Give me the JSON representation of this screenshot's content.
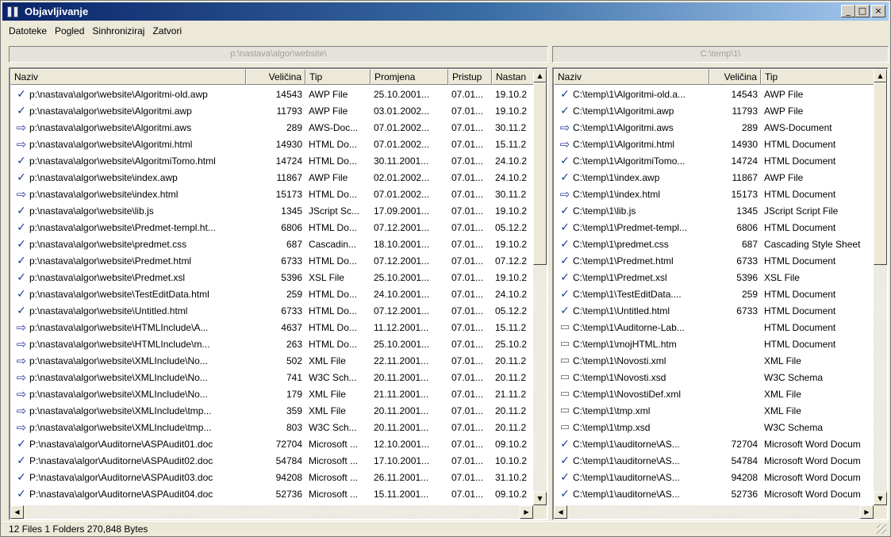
{
  "window": {
    "title": "Objavljivanje"
  },
  "caption_buttons": {
    "minimize": "_",
    "maximize": "□",
    "close": "×"
  },
  "menu": [
    "Datoteke",
    "Pogled",
    "Sinhroniziraj",
    "Zatvori"
  ],
  "left": {
    "path": "p:\\nastava\\algor\\website\\",
    "columns": [
      "Naziv",
      "Veličina",
      "Tip",
      "Promjena",
      "Pristup",
      "Nastan"
    ],
    "rows": [
      {
        "status": "check",
        "name": "p:\\nastava\\algor\\website\\Algoritmi-old.awp",
        "size": "14543",
        "type": "AWP File",
        "modified": "25.10.2001...",
        "access": "07.01...",
        "created": "19.10.2"
      },
      {
        "status": "check",
        "name": "p:\\nastava\\algor\\website\\Algoritmi.awp",
        "size": "11793",
        "type": "AWP File",
        "modified": "03.01.2002...",
        "access": "07.01...",
        "created": "19.10.2"
      },
      {
        "status": "arrow",
        "name": "p:\\nastava\\algor\\website\\Algoritmi.aws",
        "size": "289",
        "type": "AWS-Doc...",
        "modified": "07.01.2002...",
        "access": "07.01...",
        "created": "30.11.2"
      },
      {
        "status": "arrow",
        "name": "p:\\nastava\\algor\\website\\Algoritmi.html",
        "size": "14930",
        "type": "HTML Do...",
        "modified": "07.01.2002...",
        "access": "07.01...",
        "created": "15.11.2"
      },
      {
        "status": "check",
        "name": "p:\\nastava\\algor\\website\\AlgoritmiTomo.html",
        "size": "14724",
        "type": "HTML Do...",
        "modified": "30.11.2001...",
        "access": "07.01...",
        "created": "24.10.2"
      },
      {
        "status": "check",
        "name": "p:\\nastava\\algor\\website\\index.awp",
        "size": "11867",
        "type": "AWP File",
        "modified": "02.01.2002...",
        "access": "07.01...",
        "created": "24.10.2"
      },
      {
        "status": "arrow",
        "name": "p:\\nastava\\algor\\website\\index.html",
        "size": "15173",
        "type": "HTML Do...",
        "modified": "07.01.2002...",
        "access": "07.01...",
        "created": "30.11.2"
      },
      {
        "status": "check",
        "name": "p:\\nastava\\algor\\website\\lib.js",
        "size": "1345",
        "type": "JScript Sc...",
        "modified": "17.09.2001...",
        "access": "07.01...",
        "created": "19.10.2"
      },
      {
        "status": "check",
        "name": "p:\\nastava\\algor\\website\\Predmet-templ.ht...",
        "size": "6806",
        "type": "HTML Do...",
        "modified": "07.12.2001...",
        "access": "07.01...",
        "created": "05.12.2"
      },
      {
        "status": "check",
        "name": "p:\\nastava\\algor\\website\\predmet.css",
        "size": "687",
        "type": "Cascadin...",
        "modified": "18.10.2001...",
        "access": "07.01...",
        "created": "19.10.2"
      },
      {
        "status": "check",
        "name": "p:\\nastava\\algor\\website\\Predmet.html",
        "size": "6733",
        "type": "HTML Do...",
        "modified": "07.12.2001...",
        "access": "07.01...",
        "created": "07.12.2"
      },
      {
        "status": "check",
        "name": "p:\\nastava\\algor\\website\\Predmet.xsl",
        "size": "5396",
        "type": "XSL File",
        "modified": "25.10.2001...",
        "access": "07.01...",
        "created": "19.10.2"
      },
      {
        "status": "check",
        "name": "p:\\nastava\\algor\\website\\TestEditData.html",
        "size": "259",
        "type": "HTML Do...",
        "modified": "24.10.2001...",
        "access": "07.01...",
        "created": "24.10.2"
      },
      {
        "status": "check",
        "name": "p:\\nastava\\algor\\website\\Untitled.html",
        "size": "6733",
        "type": "HTML Do...",
        "modified": "07.12.2001...",
        "access": "07.01...",
        "created": "05.12.2"
      },
      {
        "status": "arrow",
        "name": "p:\\nastava\\algor\\website\\HTMLInclude\\A...",
        "size": "4637",
        "type": "HTML Do...",
        "modified": "11.12.2001...",
        "access": "07.01...",
        "created": "15.11.2"
      },
      {
        "status": "arrow",
        "name": "p:\\nastava\\algor\\website\\HTMLInclude\\m...",
        "size": "263",
        "type": "HTML Do...",
        "modified": "25.10.2001...",
        "access": "07.01...",
        "created": "25.10.2"
      },
      {
        "status": "arrow",
        "name": "p:\\nastava\\algor\\website\\XMLInclude\\No...",
        "size": "502",
        "type": "XML File",
        "modified": "22.11.2001...",
        "access": "07.01...",
        "created": "20.11.2"
      },
      {
        "status": "arrow",
        "name": "p:\\nastava\\algor\\website\\XMLInclude\\No...",
        "size": "741",
        "type": "W3C Sch...",
        "modified": "20.11.2001...",
        "access": "07.01...",
        "created": "20.11.2"
      },
      {
        "status": "arrow",
        "name": "p:\\nastava\\algor\\website\\XMLInclude\\No...",
        "size": "179",
        "type": "XML File",
        "modified": "21.11.2001...",
        "access": "07.01...",
        "created": "21.11.2"
      },
      {
        "status": "arrow",
        "name": "p:\\nastava\\algor\\website\\XMLInclude\\tmp...",
        "size": "359",
        "type": "XML File",
        "modified": "20.11.2001...",
        "access": "07.01...",
        "created": "20.11.2"
      },
      {
        "status": "arrow",
        "name": "p:\\nastava\\algor\\website\\XMLInclude\\tmp...",
        "size": "803",
        "type": "W3C Sch...",
        "modified": "20.11.2001...",
        "access": "07.01...",
        "created": "20.11.2"
      },
      {
        "status": "check",
        "name": "P:\\nastava\\algor\\Auditorne\\ASPAudit01.doc",
        "size": "72704",
        "type": "Microsoft ...",
        "modified": "12.10.2001...",
        "access": "07.01...",
        "created": "09.10.2"
      },
      {
        "status": "check",
        "name": "P:\\nastava\\algor\\Auditorne\\ASPAudit02.doc",
        "size": "54784",
        "type": "Microsoft ...",
        "modified": "17.10.2001...",
        "access": "07.01...",
        "created": "10.10.2"
      },
      {
        "status": "check",
        "name": "P:\\nastava\\algor\\Auditorne\\ASPAudit03.doc",
        "size": "94208",
        "type": "Microsoft ...",
        "modified": "26.11.2001...",
        "access": "07.01...",
        "created": "31.10.2"
      },
      {
        "status": "check",
        "name": "P:\\nastava\\algor\\Auditorne\\ASPAudit04.doc",
        "size": "52736",
        "type": "Microsoft ...",
        "modified": "15.11.2001...",
        "access": "07.01...",
        "created": "09.10.2"
      }
    ]
  },
  "right": {
    "path": "C:\\temp\\1\\",
    "columns": [
      "Naziv",
      "Veličina",
      "Tip"
    ],
    "rows": [
      {
        "status": "check",
        "name": "C:\\temp\\1\\Algoritmi-old.a...",
        "size": "14543",
        "type": "AWP File"
      },
      {
        "status": "check",
        "name": "C:\\temp\\1\\Algoritmi.awp",
        "size": "11793",
        "type": "AWP File"
      },
      {
        "status": "arrow",
        "name": "C:\\temp\\1\\Algoritmi.aws",
        "size": "289",
        "type": "AWS-Document"
      },
      {
        "status": "arrow",
        "name": "C:\\temp\\1\\Algoritmi.html",
        "size": "14930",
        "type": "HTML Document"
      },
      {
        "status": "check",
        "name": "C:\\temp\\1\\AlgoritmiTomo...",
        "size": "14724",
        "type": "HTML Document"
      },
      {
        "status": "check",
        "name": "C:\\temp\\1\\index.awp",
        "size": "11867",
        "type": "AWP File"
      },
      {
        "status": "arrow",
        "name": "C:\\temp\\1\\index.html",
        "size": "15173",
        "type": "HTML Document"
      },
      {
        "status": "check",
        "name": "C:\\temp\\1\\lib.js",
        "size": "1345",
        "type": "JScript Script File"
      },
      {
        "status": "check",
        "name": "C:\\temp\\1\\Predmet-templ...",
        "size": "6806",
        "type": "HTML Document"
      },
      {
        "status": "check",
        "name": "C:\\temp\\1\\predmet.css",
        "size": "687",
        "type": "Cascading Style Sheet"
      },
      {
        "status": "check",
        "name": "C:\\temp\\1\\Predmet.html",
        "size": "6733",
        "type": "HTML Document"
      },
      {
        "status": "check",
        "name": "C:\\temp\\1\\Predmet.xsl",
        "size": "5396",
        "type": "XSL File"
      },
      {
        "status": "check",
        "name": "C:\\temp\\1\\TestEditData....",
        "size": "259",
        "type": "HTML Document"
      },
      {
        "status": "check",
        "name": "C:\\temp\\1\\Untitled.html",
        "size": "6733",
        "type": "HTML Document"
      },
      {
        "status": "missing",
        "name": "C:\\temp\\1\\Auditorne-Lab...",
        "size": "",
        "type": "HTML Document"
      },
      {
        "status": "missing",
        "name": "C:\\temp\\1\\mojHTML.htm",
        "size": "",
        "type": "HTML Document"
      },
      {
        "status": "missing",
        "name": "C:\\temp\\1\\Novosti.xml",
        "size": "",
        "type": "XML File"
      },
      {
        "status": "missing",
        "name": "C:\\temp\\1\\Novosti.xsd",
        "size": "",
        "type": "W3C Schema"
      },
      {
        "status": "missing",
        "name": "C:\\temp\\1\\NovostiDef.xml",
        "size": "",
        "type": "XML File"
      },
      {
        "status": "missing",
        "name": "C:\\temp\\1\\tmp.xml",
        "size": "",
        "type": "XML File"
      },
      {
        "status": "missing",
        "name": "C:\\temp\\1\\tmp.xsd",
        "size": "",
        "type": "W3C Schema"
      },
      {
        "status": "check",
        "name": "C:\\temp\\1\\auditorne\\AS...",
        "size": "72704",
        "type": "Microsoft Word Docum"
      },
      {
        "status": "check",
        "name": "C:\\temp\\1\\auditorne\\AS...",
        "size": "54784",
        "type": "Microsoft Word Docum"
      },
      {
        "status": "check",
        "name": "C:\\temp\\1\\auditorne\\AS...",
        "size": "94208",
        "type": "Microsoft Word Docum"
      },
      {
        "status": "check",
        "name": "C:\\temp\\1\\auditorne\\AS...",
        "size": "52736",
        "type": "Microsoft Word Docum"
      }
    ]
  },
  "icons": {
    "check": "✓",
    "arrow": "⇨",
    "missing": "▭"
  },
  "scroll_glyphs": {
    "up": "▲",
    "down": "▼",
    "left": "◀",
    "right": "▶"
  },
  "status": "12 Files 1 Folders 270,848 Bytes"
}
